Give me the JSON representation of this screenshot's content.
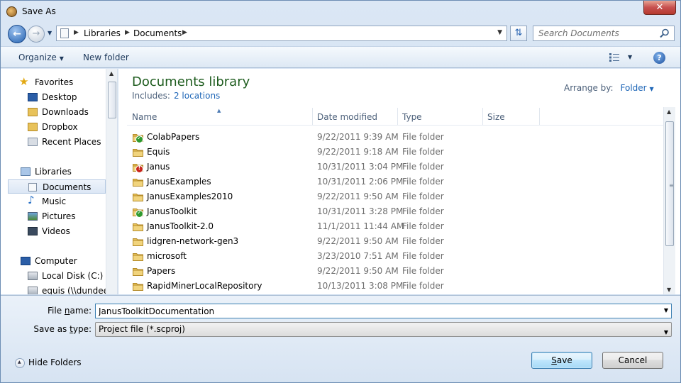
{
  "window": {
    "title": "Save As",
    "close_glyph": "✕"
  },
  "address": {
    "crumbs": [
      "Libraries",
      "Documents"
    ],
    "search_placeholder": "Search Documents"
  },
  "toolbar": {
    "organize": "Organize",
    "new_folder": "New folder",
    "help": "?"
  },
  "nav": {
    "items": [
      {
        "label": "Favorites",
        "icon": "star-icon"
      },
      {
        "label": "Desktop",
        "icon": "desktop-icon"
      },
      {
        "label": "Downloads",
        "icon": "downloads-folder-icon"
      },
      {
        "label": "Dropbox",
        "icon": "folder-icon"
      },
      {
        "label": "Recent Places",
        "icon": "recent-places-icon"
      },
      {
        "label": "Libraries",
        "icon": "libraries-icon"
      },
      {
        "label": "Documents",
        "icon": "documents-icon"
      },
      {
        "label": "Music",
        "icon": "music-icon"
      },
      {
        "label": "Pictures",
        "icon": "pictures-icon"
      },
      {
        "label": "Videos",
        "icon": "videos-icon"
      },
      {
        "label": "Computer",
        "icon": "computer-icon"
      },
      {
        "label": "Local Disk (C:)",
        "icon": "drive-icon"
      },
      {
        "label": "equis (\\\\dundee.",
        "icon": "network-drive-icon"
      }
    ]
  },
  "library": {
    "title": "Documents library",
    "includes_label": "Includes:",
    "includes_link": "2 locations",
    "arrange_label": "Arrange by:",
    "arrange_value": "Folder"
  },
  "columns": {
    "name": "Name",
    "date": "Date modified",
    "type": "Type",
    "size": "Size"
  },
  "files": [
    {
      "name": "ColabPapers",
      "date": "9/22/2011 9:39 AM",
      "type": "File folder",
      "badge": "ok"
    },
    {
      "name": "Equis",
      "date": "9/22/2011 9:18 AM",
      "type": "File folder",
      "badge": ""
    },
    {
      "name": "Janus",
      "date": "10/31/2011 3:04 PM",
      "type": "File folder",
      "badge": "warn"
    },
    {
      "name": "JanusExamples",
      "date": "10/31/2011 2:06 PM",
      "type": "File folder",
      "badge": ""
    },
    {
      "name": "JanusExamples2010",
      "date": "9/22/2011 9:50 AM",
      "type": "File folder",
      "badge": ""
    },
    {
      "name": "JanusToolkit",
      "date": "10/31/2011 3:28 PM",
      "type": "File folder",
      "badge": "ok"
    },
    {
      "name": "JanusToolkit-2.0",
      "date": "11/1/2011 11:44 AM",
      "type": "File folder",
      "badge": ""
    },
    {
      "name": "lidgren-network-gen3",
      "date": "9/22/2011 9:50 AM",
      "type": "File folder",
      "badge": ""
    },
    {
      "name": "microsoft",
      "date": "3/23/2010 7:51 AM",
      "type": "File folder",
      "badge": ""
    },
    {
      "name": "Papers",
      "date": "9/22/2011 9:50 AM",
      "type": "File folder",
      "badge": ""
    },
    {
      "name": "RapidMinerLocalRepository",
      "date": "10/13/2011 3:08 PM",
      "type": "File folder",
      "badge": ""
    }
  ],
  "form": {
    "file_name_label_pre": "File ",
    "file_name_label_u": "n",
    "file_name_label_post": "ame:",
    "file_name_value": "JanusToolkitDocumentation",
    "save_type_label_pre": "Save as ",
    "save_type_label_u": "t",
    "save_type_label_post": "ype:",
    "save_type_value": "Project file (*.scproj)",
    "hide_folders": "Hide Folders",
    "save_button_pre": "",
    "save_button_u": "S",
    "save_button_post": "ave",
    "cancel_button": "Cancel"
  },
  "colors": {
    "accent_link": "#1e66b7",
    "library_title": "#1e5c1e",
    "folder": "#e8c25a"
  }
}
